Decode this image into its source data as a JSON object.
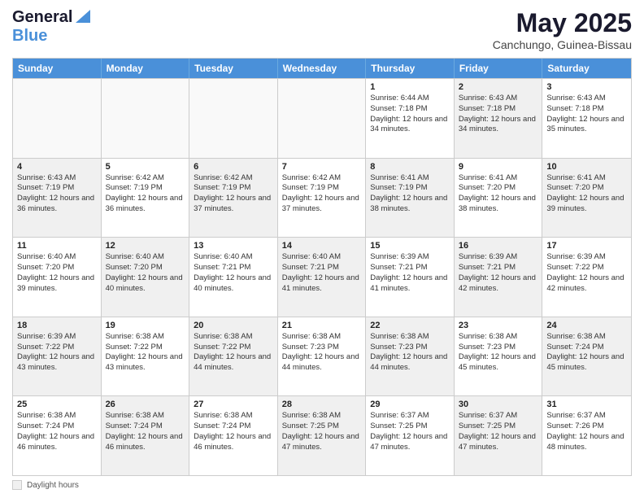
{
  "header": {
    "logo_general": "General",
    "logo_blue": "Blue",
    "title": "May 2025",
    "subtitle": "Canchungo, Guinea-Bissau"
  },
  "calendar": {
    "days_of_week": [
      "Sunday",
      "Monday",
      "Tuesday",
      "Wednesday",
      "Thursday",
      "Friday",
      "Saturday"
    ],
    "rows": [
      [
        {
          "day": "",
          "info": "",
          "shaded": false,
          "empty": true
        },
        {
          "day": "",
          "info": "",
          "shaded": false,
          "empty": true
        },
        {
          "day": "",
          "info": "",
          "shaded": false,
          "empty": true
        },
        {
          "day": "",
          "info": "",
          "shaded": false,
          "empty": true
        },
        {
          "day": "1",
          "info": "Sunrise: 6:44 AM\nSunset: 7:18 PM\nDaylight: 12 hours\nand 34 minutes.",
          "shaded": false,
          "empty": false
        },
        {
          "day": "2",
          "info": "Sunrise: 6:43 AM\nSunset: 7:18 PM\nDaylight: 12 hours\nand 34 minutes.",
          "shaded": true,
          "empty": false
        },
        {
          "day": "3",
          "info": "Sunrise: 6:43 AM\nSunset: 7:18 PM\nDaylight: 12 hours\nand 35 minutes.",
          "shaded": false,
          "empty": false
        }
      ],
      [
        {
          "day": "4",
          "info": "Sunrise: 6:43 AM\nSunset: 7:19 PM\nDaylight: 12 hours\nand 36 minutes.",
          "shaded": true,
          "empty": false
        },
        {
          "day": "5",
          "info": "Sunrise: 6:42 AM\nSunset: 7:19 PM\nDaylight: 12 hours\nand 36 minutes.",
          "shaded": false,
          "empty": false
        },
        {
          "day": "6",
          "info": "Sunrise: 6:42 AM\nSunset: 7:19 PM\nDaylight: 12 hours\nand 37 minutes.",
          "shaded": true,
          "empty": false
        },
        {
          "day": "7",
          "info": "Sunrise: 6:42 AM\nSunset: 7:19 PM\nDaylight: 12 hours\nand 37 minutes.",
          "shaded": false,
          "empty": false
        },
        {
          "day": "8",
          "info": "Sunrise: 6:41 AM\nSunset: 7:19 PM\nDaylight: 12 hours\nand 38 minutes.",
          "shaded": true,
          "empty": false
        },
        {
          "day": "9",
          "info": "Sunrise: 6:41 AM\nSunset: 7:20 PM\nDaylight: 12 hours\nand 38 minutes.",
          "shaded": false,
          "empty": false
        },
        {
          "day": "10",
          "info": "Sunrise: 6:41 AM\nSunset: 7:20 PM\nDaylight: 12 hours\nand 39 minutes.",
          "shaded": true,
          "empty": false
        }
      ],
      [
        {
          "day": "11",
          "info": "Sunrise: 6:40 AM\nSunset: 7:20 PM\nDaylight: 12 hours\nand 39 minutes.",
          "shaded": false,
          "empty": false
        },
        {
          "day": "12",
          "info": "Sunrise: 6:40 AM\nSunset: 7:20 PM\nDaylight: 12 hours\nand 40 minutes.",
          "shaded": true,
          "empty": false
        },
        {
          "day": "13",
          "info": "Sunrise: 6:40 AM\nSunset: 7:21 PM\nDaylight: 12 hours\nand 40 minutes.",
          "shaded": false,
          "empty": false
        },
        {
          "day": "14",
          "info": "Sunrise: 6:40 AM\nSunset: 7:21 PM\nDaylight: 12 hours\nand 41 minutes.",
          "shaded": true,
          "empty": false
        },
        {
          "day": "15",
          "info": "Sunrise: 6:39 AM\nSunset: 7:21 PM\nDaylight: 12 hours\nand 41 minutes.",
          "shaded": false,
          "empty": false
        },
        {
          "day": "16",
          "info": "Sunrise: 6:39 AM\nSunset: 7:21 PM\nDaylight: 12 hours\nand 42 minutes.",
          "shaded": true,
          "empty": false
        },
        {
          "day": "17",
          "info": "Sunrise: 6:39 AM\nSunset: 7:22 PM\nDaylight: 12 hours\nand 42 minutes.",
          "shaded": false,
          "empty": false
        }
      ],
      [
        {
          "day": "18",
          "info": "Sunrise: 6:39 AM\nSunset: 7:22 PM\nDaylight: 12 hours\nand 43 minutes.",
          "shaded": true,
          "empty": false
        },
        {
          "day": "19",
          "info": "Sunrise: 6:38 AM\nSunset: 7:22 PM\nDaylight: 12 hours\nand 43 minutes.",
          "shaded": false,
          "empty": false
        },
        {
          "day": "20",
          "info": "Sunrise: 6:38 AM\nSunset: 7:22 PM\nDaylight: 12 hours\nand 44 minutes.",
          "shaded": true,
          "empty": false
        },
        {
          "day": "21",
          "info": "Sunrise: 6:38 AM\nSunset: 7:23 PM\nDaylight: 12 hours\nand 44 minutes.",
          "shaded": false,
          "empty": false
        },
        {
          "day": "22",
          "info": "Sunrise: 6:38 AM\nSunset: 7:23 PM\nDaylight: 12 hours\nand 44 minutes.",
          "shaded": true,
          "empty": false
        },
        {
          "day": "23",
          "info": "Sunrise: 6:38 AM\nSunset: 7:23 PM\nDaylight: 12 hours\nand 45 minutes.",
          "shaded": false,
          "empty": false
        },
        {
          "day": "24",
          "info": "Sunrise: 6:38 AM\nSunset: 7:24 PM\nDaylight: 12 hours\nand 45 minutes.",
          "shaded": true,
          "empty": false
        }
      ],
      [
        {
          "day": "25",
          "info": "Sunrise: 6:38 AM\nSunset: 7:24 PM\nDaylight: 12 hours\nand 46 minutes.",
          "shaded": false,
          "empty": false
        },
        {
          "day": "26",
          "info": "Sunrise: 6:38 AM\nSunset: 7:24 PM\nDaylight: 12 hours\nand 46 minutes.",
          "shaded": true,
          "empty": false
        },
        {
          "day": "27",
          "info": "Sunrise: 6:38 AM\nSunset: 7:24 PM\nDaylight: 12 hours\nand 46 minutes.",
          "shaded": false,
          "empty": false
        },
        {
          "day": "28",
          "info": "Sunrise: 6:38 AM\nSunset: 7:25 PM\nDaylight: 12 hours\nand 47 minutes.",
          "shaded": true,
          "empty": false
        },
        {
          "day": "29",
          "info": "Sunrise: 6:37 AM\nSunset: 7:25 PM\nDaylight: 12 hours\nand 47 minutes.",
          "shaded": false,
          "empty": false
        },
        {
          "day": "30",
          "info": "Sunrise: 6:37 AM\nSunset: 7:25 PM\nDaylight: 12 hours\nand 47 minutes.",
          "shaded": true,
          "empty": false
        },
        {
          "day": "31",
          "info": "Sunrise: 6:37 AM\nSunset: 7:26 PM\nDaylight: 12 hours\nand 48 minutes.",
          "shaded": false,
          "empty": false
        }
      ]
    ]
  },
  "legend": {
    "label": "Daylight hours"
  }
}
